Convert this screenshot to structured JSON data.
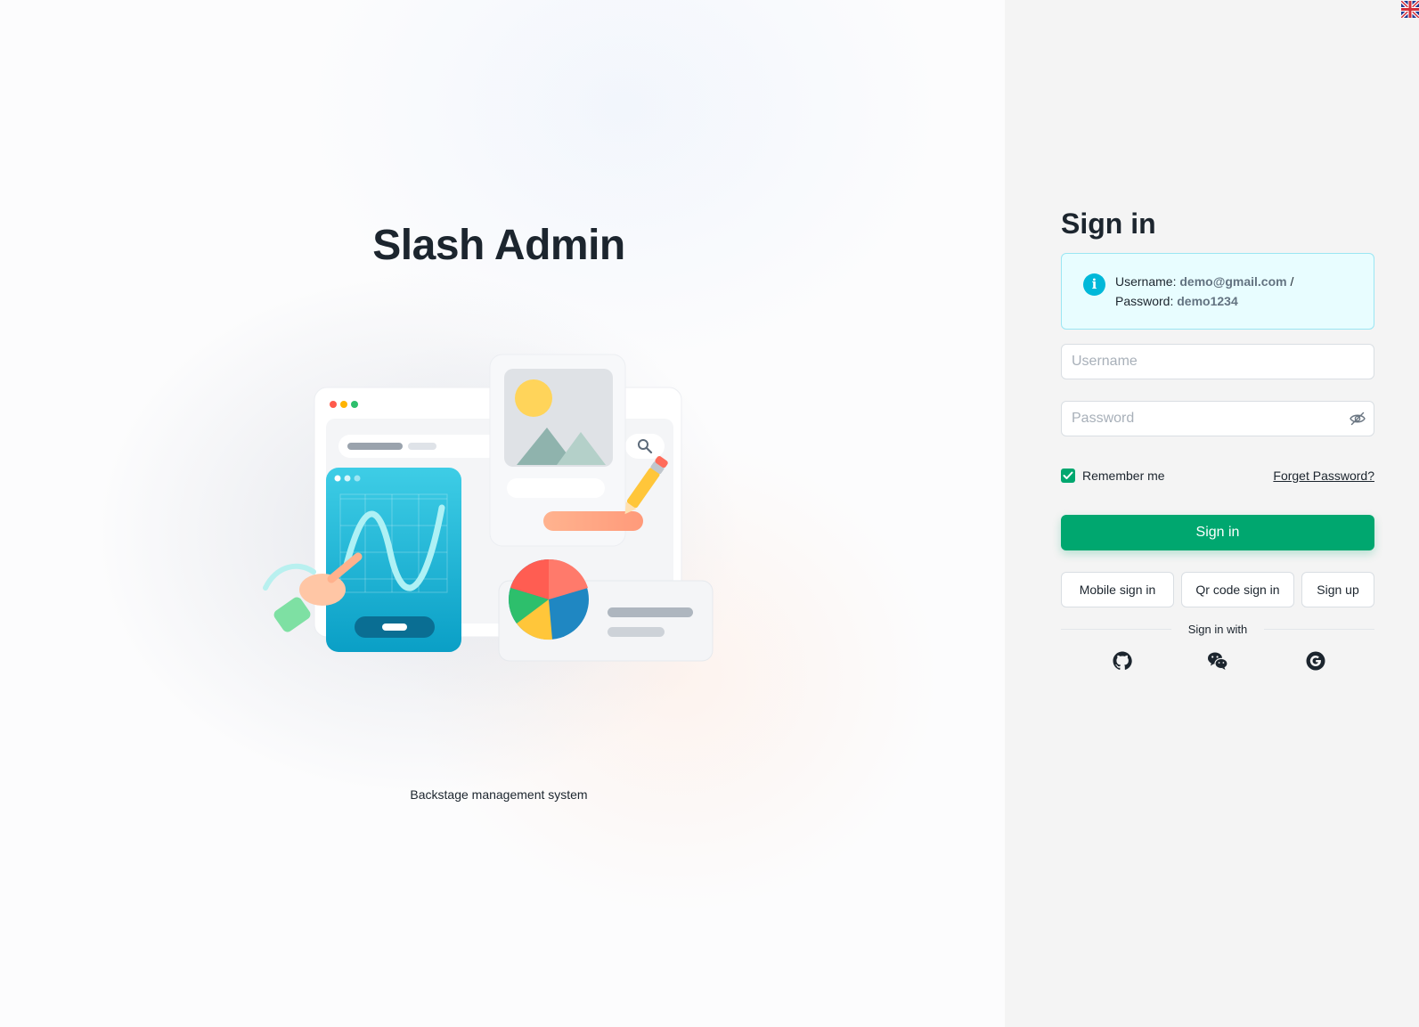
{
  "brand": {
    "title": "Slash Admin",
    "subtitle": "Backstage management system"
  },
  "language": {
    "icon": "uk-flag-icon"
  },
  "login": {
    "title": "Sign in",
    "info": {
      "username_label": "Username:",
      "username_value": "demo@gmail.com",
      "separator": "/",
      "password_label": "Password:",
      "password_value": "demo1234"
    },
    "username_placeholder": "Username",
    "password_placeholder": "Password",
    "remember_label": "Remember me",
    "remember_checked": true,
    "forgot_label": "Forget Password?",
    "submit_label": "Sign in",
    "mobile_label": "Mobile sign in",
    "qr_label": "Qr code sign in",
    "signup_label": "Sign up",
    "social_label": "Sign in with",
    "social_icons": [
      "github-icon",
      "wechat-icon",
      "google-icon"
    ]
  },
  "colors": {
    "primary": "#00a76f",
    "info_bg": "#e8fdff",
    "info_icon": "#00b8d9",
    "right_pane_bg": "#f4f4f4"
  }
}
